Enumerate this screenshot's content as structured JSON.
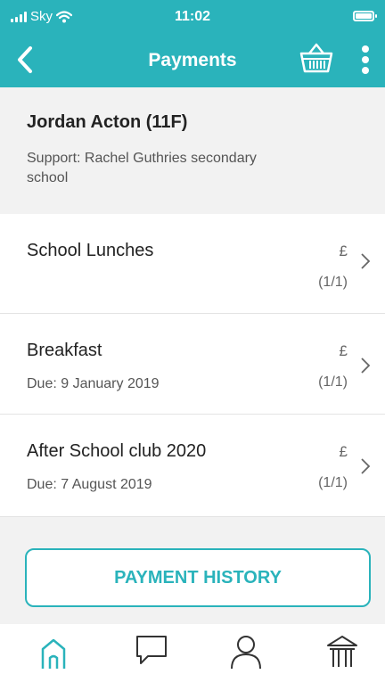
{
  "status_bar": {
    "carrier": "Sky",
    "time": "11:02"
  },
  "header": {
    "title": "Payments",
    "icons": [
      "back-chevron-icon",
      "basket-icon",
      "more-vertical-icon"
    ]
  },
  "student": {
    "name": "Jordan Acton (11F)",
    "support": "Support: Rachel Guthries secondary school"
  },
  "payments": [
    {
      "title": "School Lunches",
      "due": "",
      "currency": "£",
      "count": "(1/1)"
    },
    {
      "title": "Breakfast",
      "due": "Due: 9 January 2019",
      "currency": "£",
      "count": "(1/1)"
    },
    {
      "title": "After School club 2020",
      "due": "Due: 7 August 2019",
      "currency": "£",
      "count": "(1/1)"
    }
  ],
  "history_button": "PAYMENT HISTORY",
  "tab_bar": {
    "icons": [
      "home-icon",
      "chat-icon",
      "profile-icon",
      "bank-icon"
    ]
  },
  "colors": {
    "accent": "#2ab3bb",
    "background": "#f2f2f2"
  }
}
